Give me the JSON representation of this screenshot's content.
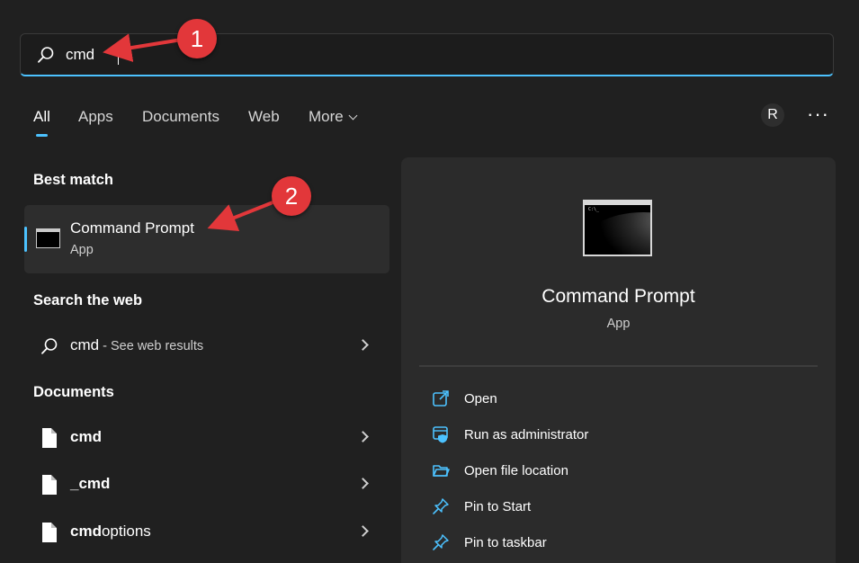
{
  "search": {
    "value": "cmd",
    "placeholder": ""
  },
  "tabs": [
    {
      "label": "All",
      "active": true
    },
    {
      "label": "Apps"
    },
    {
      "label": "Documents"
    },
    {
      "label": "Web"
    },
    {
      "label": "More"
    }
  ],
  "header": {
    "avatar_initial": "R",
    "more_label": "···"
  },
  "best_match": {
    "section_title": "Best match",
    "title": "Command Prompt",
    "subtitle": "App",
    "icon": "command-prompt-icon"
  },
  "web": {
    "section_title": "Search the web",
    "query": "cmd",
    "suffix": " - See web results"
  },
  "documents": {
    "section_title": "Documents",
    "items": [
      {
        "prefix": "cmd",
        "rest": ""
      },
      {
        "prefix": "_cmd",
        "rest": ""
      },
      {
        "prefix": "cmd",
        "rest": "options"
      }
    ]
  },
  "details": {
    "title": "Command Prompt",
    "subtitle": "App",
    "terminal_text": "C:\\_",
    "actions": [
      {
        "label": "Open",
        "icon": "open-external-icon"
      },
      {
        "label": "Run as administrator",
        "icon": "shield-window-icon"
      },
      {
        "label": "Open file location",
        "icon": "folder-open-icon"
      },
      {
        "label": "Pin to Start",
        "icon": "pin-icon"
      },
      {
        "label": "Pin to taskbar",
        "icon": "pin-icon"
      }
    ]
  },
  "annotations": [
    "1",
    "2"
  ],
  "colors": {
    "accent": "#4cc2ff",
    "annotation": "#e2373a",
    "background": "#202020",
    "panel": "#2b2b2b"
  }
}
